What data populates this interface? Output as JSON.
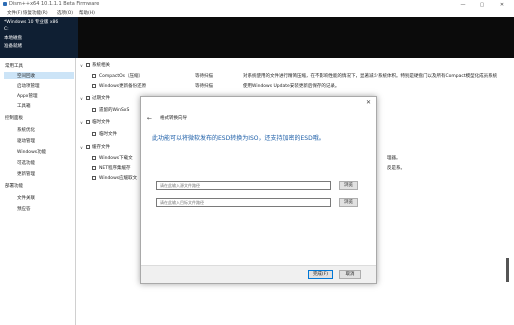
{
  "window": {
    "title": "Dism++x64 10.1.1.1 Beta Firmware",
    "minimize": "—",
    "maximize": "▢",
    "close": "✕"
  },
  "menu": [
    "文件(F)",
    "恢复功能(R)",
    "选项(O)",
    "帮助(H)"
  ],
  "banner": {
    "os_name": "*Windows 10 专业版 x86",
    "drive": "C:",
    "status_line1": "本地磁盘",
    "status_line2": "准备就绪"
  },
  "sidebar": {
    "groups": [
      {
        "label": "常用工具",
        "items": [
          "空间回收",
          "启动项管理",
          "Appx管理",
          "工具箱"
        ]
      },
      {
        "label": "控制面板",
        "items": [
          "系统优化",
          "驱动管理",
          "Windows功能",
          "可选功能",
          "更新管理"
        ]
      },
      {
        "label": "部署功能",
        "items": [
          "文件关联",
          "预应答"
        ]
      }
    ],
    "selected_item": "空间回收"
  },
  "main": {
    "sections": [
      {
        "title": "系统相关",
        "items": [
          {
            "label": "CompactOs（压缩）",
            "status": "等待扫描",
            "description": "对系统使用的文件进行精简压缩，在不影响性能的情况下，显著减少系统体积。特别是硬盘门以及所有Compact模型化成员系统"
          },
          {
            "label": "Windows更新备份还原",
            "status": "等待扫描",
            "description": "使用Windows Update安装更新后保存的记录。"
          }
        ]
      },
      {
        "title": "过期文件",
        "items": [
          {
            "label": "遗留的WinSxS",
            "status": "",
            "description": ""
          }
        ]
      },
      {
        "title": "临时文件",
        "items": [
          {
            "label": "临时文件",
            "status": "",
            "description": ""
          }
        ]
      },
      {
        "title": "缓存文件",
        "items": [
          {
            "label": "Windows下载文",
            "status": "",
            "description": "理器。"
          },
          {
            "label": "NET程序集缓存",
            "status": "",
            "description": "反是系。"
          },
          {
            "label": "Windows应缓取文",
            "status": "",
            "description": ""
          }
        ]
      }
    ]
  },
  "dialog": {
    "title": "格式转换向导",
    "heading": "此功能可以将微软发布的ESD转换为ISO，还支持加密的ESD哦。",
    "source_placeholder": "请在此输入源文件路径",
    "target_placeholder": "请在此输入目标文件路径",
    "browse_label": "浏览",
    "ok_label": "完成(F)",
    "cancel_label": "取消",
    "back_icon": "←",
    "close_icon": "✕"
  },
  "colors": {
    "banner_dark": "#0f1f33",
    "banner_black": "#0b0b0b",
    "heading_blue": "#1e5fa8",
    "selection": "#cce4f7"
  }
}
